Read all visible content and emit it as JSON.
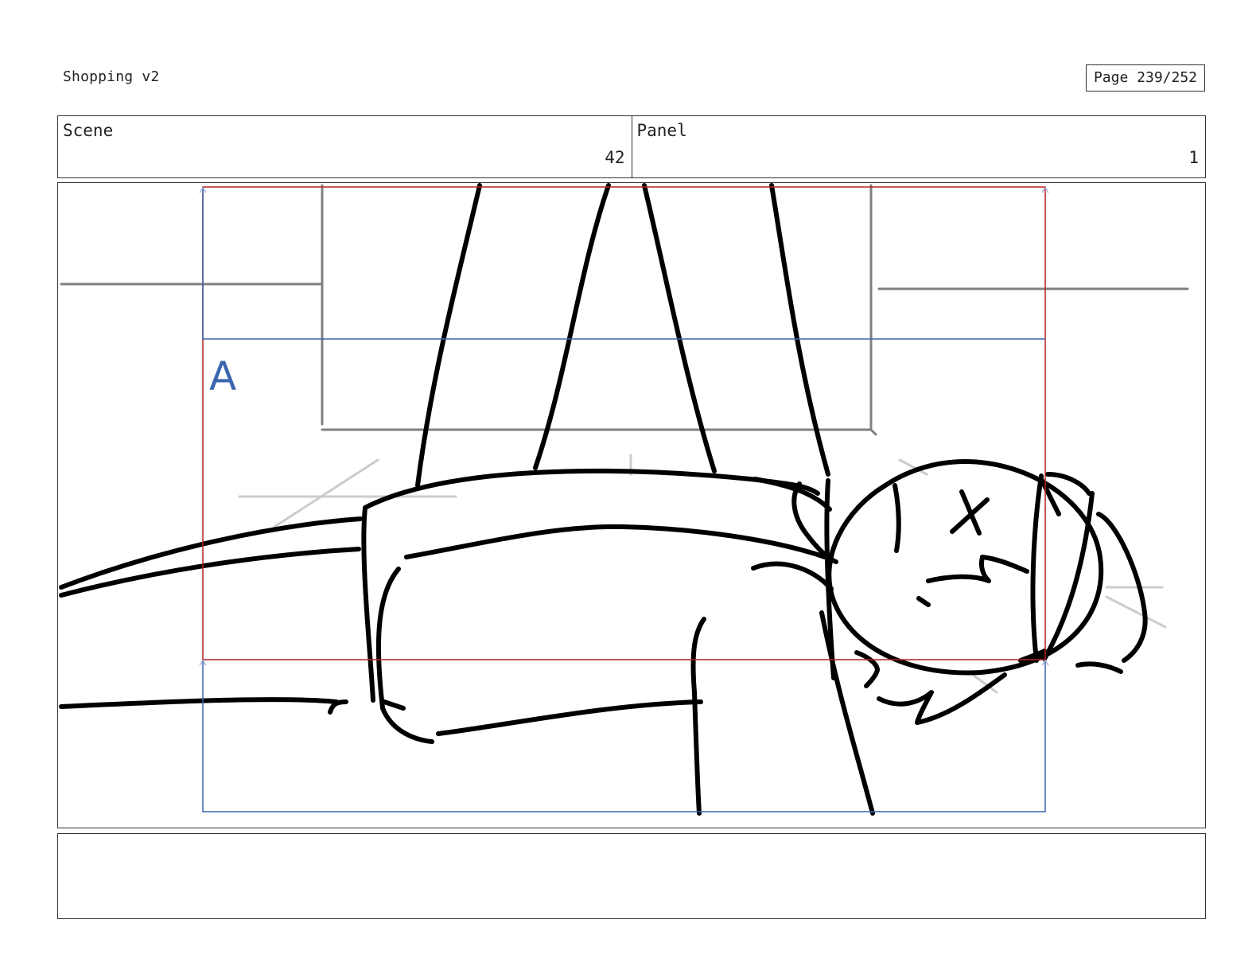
{
  "document": {
    "title": "Shopping v2",
    "page_label": "Page 239/252"
  },
  "info": {
    "scene_label": "Scene",
    "scene_number": "42",
    "panel_label": "Panel",
    "panel_number": "1"
  },
  "drawing": {
    "safe_area_marker": "A",
    "colors": {
      "sketch_stroke": "#000000",
      "background_lines": "#808080",
      "faint_lines": "#cccccc",
      "title_safe_frame": "#b22222",
      "action_safe_frame": "#3a66b0"
    }
  },
  "notes": {
    "text": ""
  }
}
